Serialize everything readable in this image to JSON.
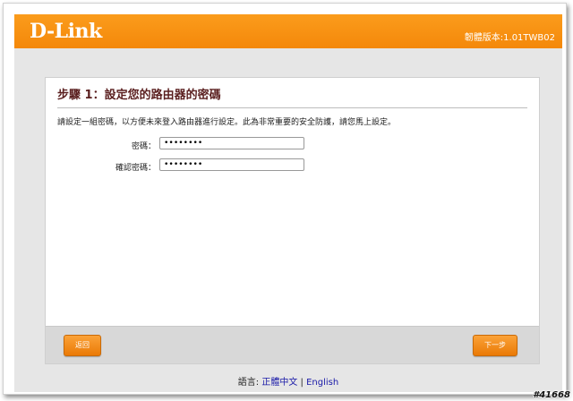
{
  "header": {
    "logo": "D-Link",
    "firmware": "韌體版本:1.01TWB02"
  },
  "wizard": {
    "title": "步驟 1：設定您的路由器的密碼",
    "description": "請設定一組密碼，以方便未來登入路由器進行設定。此為非常重要的安全防護，請您馬上設定。",
    "fields": [
      {
        "label": "密碼：",
        "value": "••••••••"
      },
      {
        "label": "確認密碼：",
        "value": "••••••••"
      }
    ],
    "back_label": "返回",
    "next_label": "下一步"
  },
  "language": {
    "label": "語言:",
    "options": [
      "正體中文",
      "English"
    ],
    "separator": "|"
  },
  "watermark": "#41668"
}
